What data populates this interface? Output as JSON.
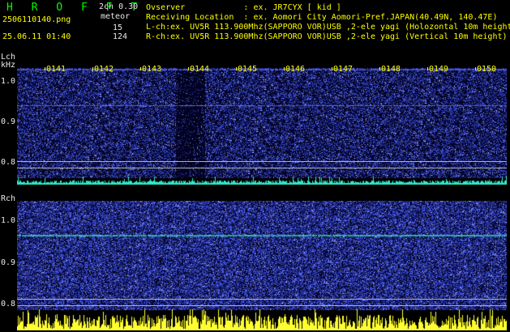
{
  "header": {
    "app_title": "H R O F F T",
    "version": "2ch 0.30",
    "filename": "2506110140.png",
    "datetime": "25.06.11 01:40",
    "meteor_label": "meteor",
    "meteor_count_l": "15",
    "meteor_count_r": "124",
    "info_lines": [
      "Ovserver            : ex. JR7CYX [ kid ]",
      "Receiving Location  : ex. Aomori City Aomori-Pref.JAPAN(40.49N, 140.47E)",
      "L-ch:ex. UV5R 113.900Mhz(SAPPORO VOR)USB ,2-ele yagi (Holozontal 10m height",
      "R-ch:ex. UV5R 113.900Mhz(SAPPORO VOR)USB ,2-ele yagi (Vertical 10m height)"
    ]
  },
  "left_channel": {
    "label": "Lch",
    "unit": "kHz",
    "y_ticks": [
      "1.0",
      "0.9",
      "0.8"
    ],
    "time_ticks": [
      "0141",
      "0142",
      "0143",
      "0144",
      "0145",
      "0146",
      "0147",
      "0148",
      "0149",
      "0150"
    ]
  },
  "right_channel": {
    "label": "Rch",
    "y_ticks": [
      "1.0",
      "0.9",
      "0.8"
    ]
  },
  "colors": {
    "background": "#000000",
    "header_yellow": "#ffff00",
    "header_green": "#00ff00",
    "spectrum_noise": "#1a2a9a",
    "bar_cyan": "#2fe8c8",
    "bar_yellow": "#ffff30"
  }
}
